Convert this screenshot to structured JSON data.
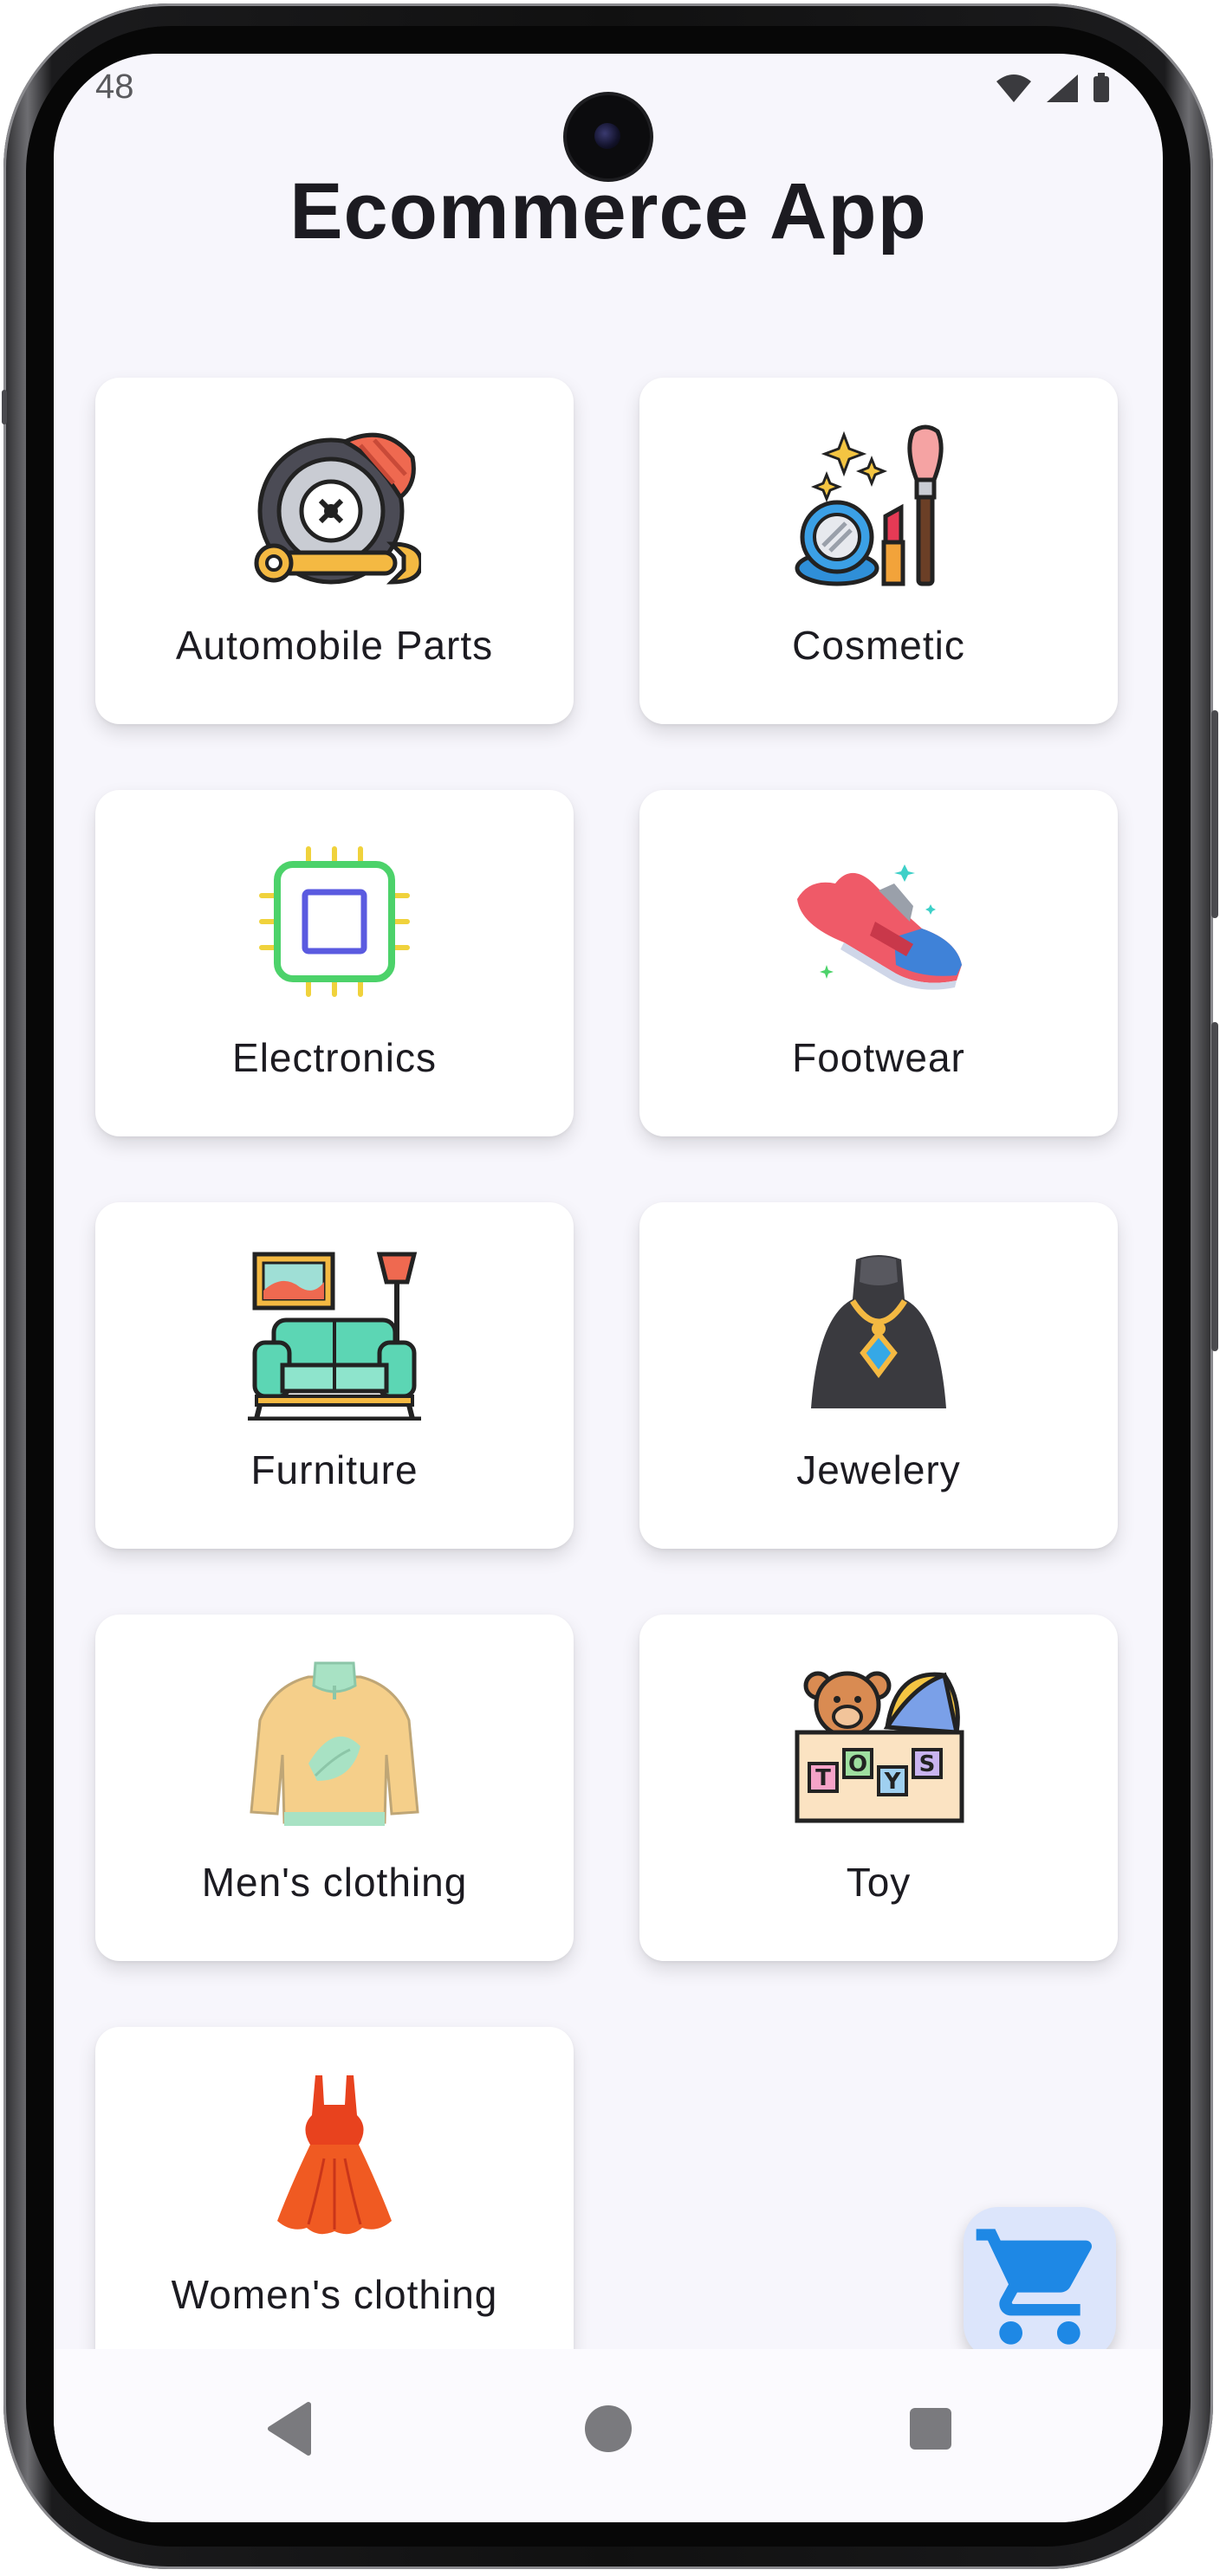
{
  "status_bar": {
    "time": "48",
    "icons": [
      "wifi-icon",
      "signal-icon",
      "battery-icon"
    ]
  },
  "header": {
    "title": "Ecommerce App"
  },
  "categories": [
    {
      "label": "Automobile Parts",
      "icon": "automobile-parts-icon"
    },
    {
      "label": "Cosmetic",
      "icon": "cosmetic-icon"
    },
    {
      "label": "Electronics",
      "icon": "electronics-chip-icon"
    },
    {
      "label": "Footwear",
      "icon": "sneaker-icon"
    },
    {
      "label": "Furniture",
      "icon": "sofa-icon"
    },
    {
      "label": "Jewelery",
      "icon": "necklace-icon"
    },
    {
      "label": "Men's clothing",
      "icon": "sweater-icon"
    },
    {
      "label": "Toy",
      "icon": "toy-box-icon"
    },
    {
      "label": "Women's clothing",
      "icon": "dress-icon"
    }
  ],
  "fab": {
    "icon": "shopping-cart-icon"
  },
  "colors": {
    "screen_background": "#f7f6fc",
    "card_background": "#ffffff",
    "fab_background": "#dce5fb",
    "cart_blue": "#1e88e5",
    "text": "#1c1b21"
  },
  "nav_bar": {
    "buttons": [
      "back-icon",
      "home-icon",
      "recents-icon"
    ]
  }
}
